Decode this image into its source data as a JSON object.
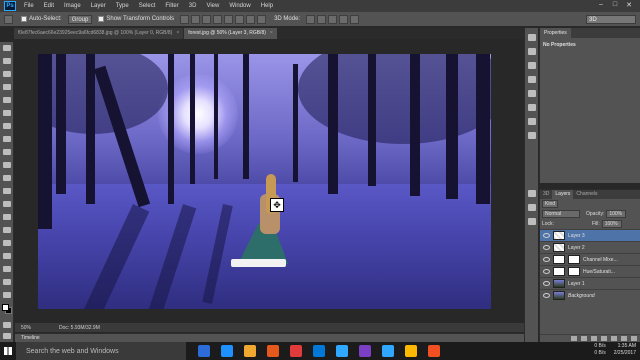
{
  "app": {
    "logo_text": "Ps"
  },
  "menu": [
    "File",
    "Edit",
    "Image",
    "Layer",
    "Type",
    "Select",
    "Filter",
    "3D",
    "View",
    "Window",
    "Help"
  ],
  "window_controls": [
    "–",
    "□",
    "✕"
  ],
  "options_bar": {
    "auto_select_label": "Auto-Select:",
    "auto_select_value": "Group",
    "show_transform_label": "Show Transform Controls",
    "mode_3d_label": "3D Mode:",
    "workspace_value": "3D"
  },
  "tabs": [
    {
      "label": "f0e87fec6aec66e23925eec9a6fcd6838.jpg @ 100% (Layer 0, RGB/8)",
      "close": "×",
      "active": false
    },
    {
      "label": "forest.jpg @ 50% (Layer 3, RGB/8)",
      "close": "×",
      "active": true
    }
  ],
  "status": {
    "zoom": "50%",
    "doc": "Doc: 5.93M/32.9M"
  },
  "timeline_label": "Timeline",
  "properties": {
    "tab_label": "Properties",
    "body": "No Properties"
  },
  "layers_panel": {
    "tabs": [
      "3D",
      "Layers",
      "Channels"
    ],
    "kind_label": "Kind",
    "blend_mode": "Normal",
    "opacity_label": "Opacity:",
    "opacity_value": "100%",
    "lock_label": "Lock:",
    "fill_label": "Fill:",
    "fill_value": "100%",
    "layers": [
      {
        "name": "Layer 3",
        "selected": true,
        "thumb": "transparent"
      },
      {
        "name": "Layer 2",
        "selected": false,
        "thumb": "transparent"
      },
      {
        "name": "Channel Mixe...",
        "selected": false,
        "thumb": "adjustment"
      },
      {
        "name": "Hue/Saturati...",
        "selected": false,
        "thumb": "adjustment"
      },
      {
        "name": "Layer 1",
        "selected": false,
        "thumb": "image"
      },
      {
        "name": "Background",
        "selected": false,
        "thumb": "image"
      }
    ]
  },
  "taskbar": {
    "search_placeholder": "Search the web and Windows",
    "icon_colors": [
      "#2b6cd9",
      "#1e90ff",
      "#f0a830",
      "#e55a1c",
      "#e23b3b",
      "#0078d7",
      "#31a8ff",
      "#7b3fc4",
      "#31a8ff",
      "#ffb900",
      "#f25022"
    ],
    "tray": {
      "net1": "0 B/s",
      "net2": "0 B/s",
      "time": "1:35 AM",
      "date": "2/25/2017"
    }
  }
}
